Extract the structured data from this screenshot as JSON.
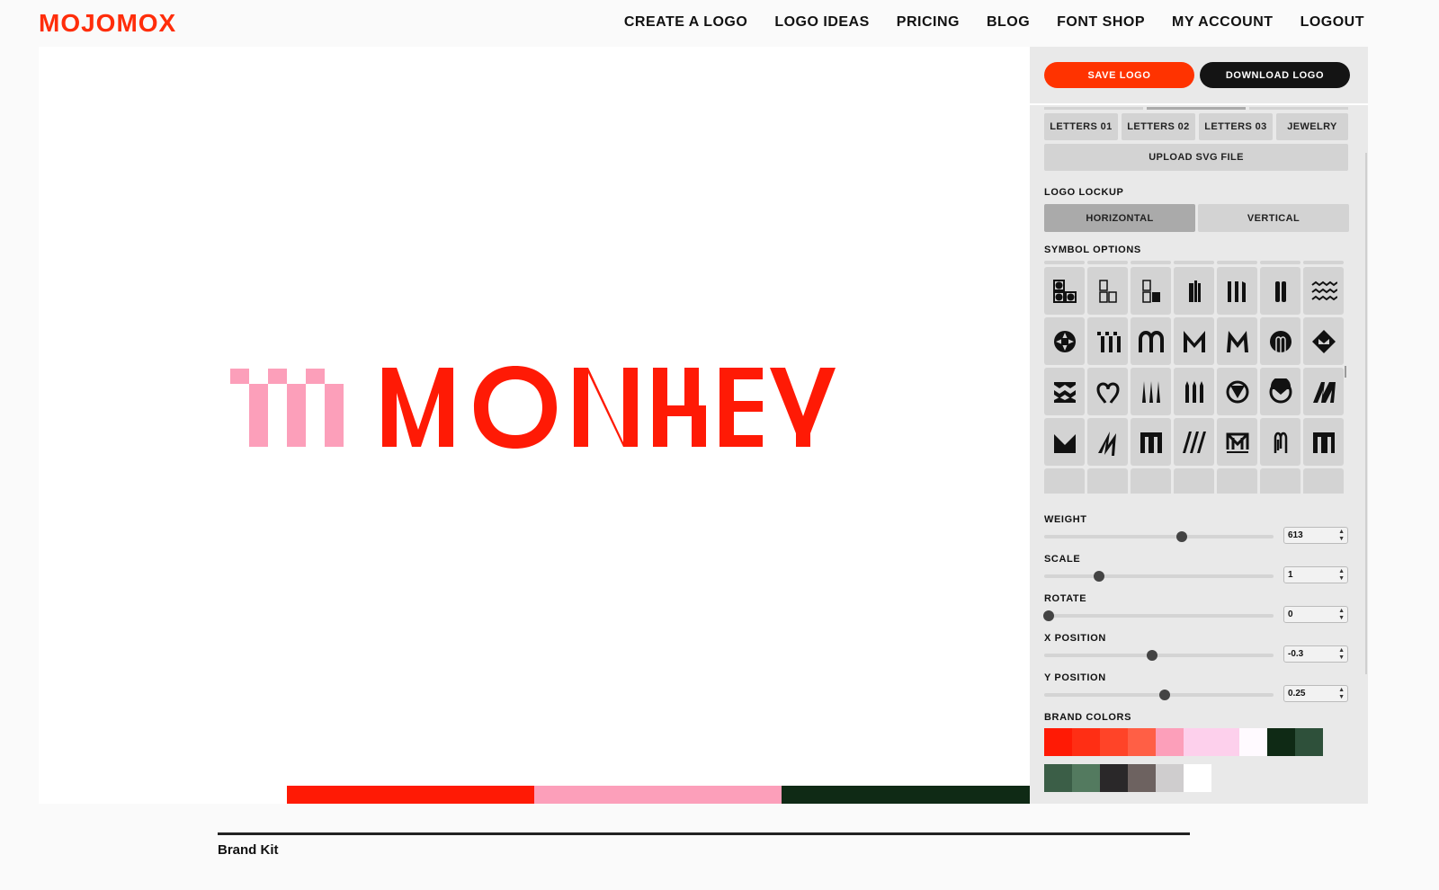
{
  "header": {
    "brand": "MOJOMOX",
    "nav": [
      "CREATE A LOGO",
      "LOGO IDEAS",
      "PRICING",
      "BLOG",
      "FONT SHOP",
      "MY ACCOUNT",
      "LOGOUT"
    ]
  },
  "logo": {
    "wordmark": "MONHEY",
    "wordmark_color": "#ff1a05",
    "symbol_color": "#fc9fba",
    "stripe_colors": [
      "#ff1a05",
      "#fc9fba",
      "#0f2a15"
    ]
  },
  "panel": {
    "save_label": "SAVE LOGO",
    "download_label": "DOWNLOAD LOGO",
    "categories": [
      "LETTERS 01",
      "LETTERS 02",
      "LETTERS 03",
      "JEWELRY"
    ],
    "upload_label": "UPLOAD SVG FILE",
    "lockup_label": "LOGO LOCKUP",
    "lockup_options": [
      "HORIZONTAL",
      "VERTICAL"
    ],
    "lockup_selected": "HORIZONTAL",
    "symbol_label": "SYMBOL OPTIONS",
    "symbols": [
      "squares-circles-icon",
      "squares-outline-icon",
      "squares-filled-icon",
      "bars-narrow-icon",
      "bars-three-icon",
      "bars-two-icon",
      "waves-icon",
      "star-circle-icon",
      "pixel-m-icon",
      "arch-m-icon",
      "angular-m-icon",
      "angular-m-alt-icon",
      "circle-m-icon",
      "diamond-m-icon",
      "zigzag-icon",
      "heart-m-icon",
      "spikes-icon",
      "pillars-icon",
      "circle-v-icon",
      "circle-envelope-icon",
      "slant-m-icon",
      "solid-m-icon",
      "lightning-m-icon",
      "square-m-icon",
      "slashes-icon",
      "underline-m-icon",
      "clip-m-icon",
      "serif-m-icon",
      "partial-m-1-icon",
      "partial-m-2-icon",
      "partial-m-3-icon",
      "partial-m-4-icon",
      "partial-m-5-icon",
      "partial-m-6-icon",
      "partial-m-7-icon"
    ],
    "sliders": [
      {
        "label": "WEIGHT",
        "value": "613",
        "fraction": 0.6
      },
      {
        "label": "SCALE",
        "value": "1",
        "fraction": 0.24
      },
      {
        "label": "ROTATE",
        "value": "0",
        "fraction": 0.02
      },
      {
        "label": "X POSITION",
        "value": "-0.3",
        "fraction": 0.47
      },
      {
        "label": "Y POSITION",
        "value": "0.25",
        "fraction": 0.525
      }
    ],
    "brand_colors_label": "BRAND COLORS",
    "brand_colors_row1": [
      "#ff1a05",
      "#ff2e14",
      "#ff4428",
      "#ff5f45",
      "#fc9fba",
      "#fdd0ec",
      "#fdd0ec",
      "#fffaff",
      "#0f2a15",
      "#2e503a"
    ],
    "brand_colors_row2": [
      "#3b5e47",
      "#537a5f",
      "#2a2829",
      "#6d6260",
      "#cfcdce",
      "#ffffff"
    ]
  },
  "footer": {
    "brand_kit": "Brand Kit"
  }
}
